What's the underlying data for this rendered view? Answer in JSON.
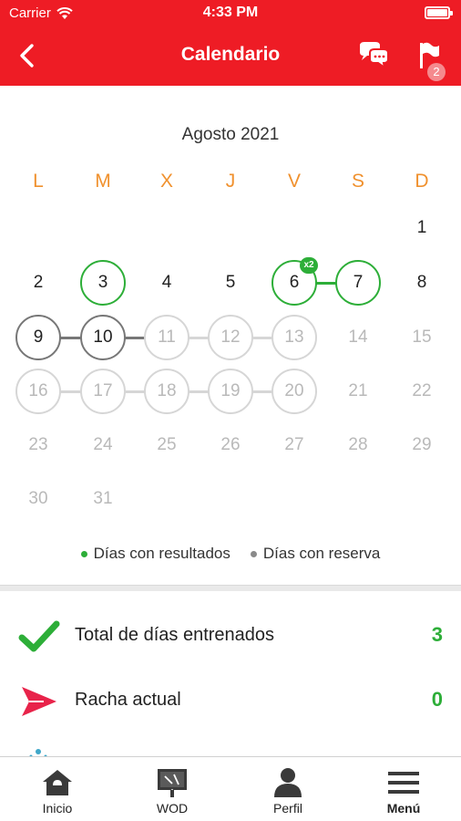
{
  "status_bar": {
    "carrier": "Carrier",
    "time": "4:33 PM"
  },
  "nav": {
    "title": "Calendario",
    "back_icon": "chevron-left-icon",
    "chat_icon": "chat-bubbles-icon",
    "flag_icon": "flag-icon",
    "flag_badge": "2"
  },
  "calendar": {
    "month": "Agosto 2021",
    "weekdays": [
      "L",
      "M",
      "X",
      "J",
      "V",
      "S",
      "D"
    ],
    "days": [
      {
        "label": "1",
        "state": "plain"
      },
      {
        "label": "2",
        "state": "plain"
      },
      {
        "label": "3",
        "state": "result"
      },
      {
        "label": "4",
        "state": "plain"
      },
      {
        "label": "5",
        "state": "plain"
      },
      {
        "label": "6",
        "state": "result",
        "badge": "x2"
      },
      {
        "label": "7",
        "state": "result"
      },
      {
        "label": "8",
        "state": "plain"
      },
      {
        "label": "9",
        "state": "reservation"
      },
      {
        "label": "10",
        "state": "reservation"
      },
      {
        "label": "11",
        "state": "future"
      },
      {
        "label": "12",
        "state": "future"
      },
      {
        "label": "13",
        "state": "future"
      },
      {
        "label": "14",
        "state": "faded"
      },
      {
        "label": "15",
        "state": "faded"
      },
      {
        "label": "16",
        "state": "future"
      },
      {
        "label": "17",
        "state": "future"
      },
      {
        "label": "18",
        "state": "future"
      },
      {
        "label": "19",
        "state": "future"
      },
      {
        "label": "20",
        "state": "future"
      },
      {
        "label": "21",
        "state": "faded"
      },
      {
        "label": "22",
        "state": "faded"
      },
      {
        "label": "23",
        "state": "faded"
      },
      {
        "label": "24",
        "state": "faded"
      },
      {
        "label": "25",
        "state": "faded"
      },
      {
        "label": "26",
        "state": "faded"
      },
      {
        "label": "27",
        "state": "faded"
      },
      {
        "label": "28",
        "state": "faded"
      },
      {
        "label": "29",
        "state": "faded"
      },
      {
        "label": "30",
        "state": "faded"
      },
      {
        "label": "31",
        "state": "faded"
      }
    ],
    "legend": {
      "results_label": "Días con resultados",
      "reservations_label": "Días con reserva",
      "results_color": "#2dae38",
      "reservations_color": "#8a8a8a"
    }
  },
  "stats": [
    {
      "icon": "checkmark-icon",
      "label": "Total de días entrenados",
      "value": "3"
    },
    {
      "icon": "paper-plane-icon",
      "label": "Racha actual",
      "value": "0"
    }
  ],
  "tabs": [
    {
      "icon": "home-icon",
      "label": "Inicio"
    },
    {
      "icon": "whiteboard-icon",
      "label": "WOD"
    },
    {
      "icon": "user-icon",
      "label": "Perfil"
    },
    {
      "icon": "hamburger-menu-icon",
      "label": "Menú",
      "active": true
    }
  ],
  "colors": {
    "brand": "#ee1c25",
    "accent_weekday": "#f0912e",
    "success": "#2dae38"
  }
}
